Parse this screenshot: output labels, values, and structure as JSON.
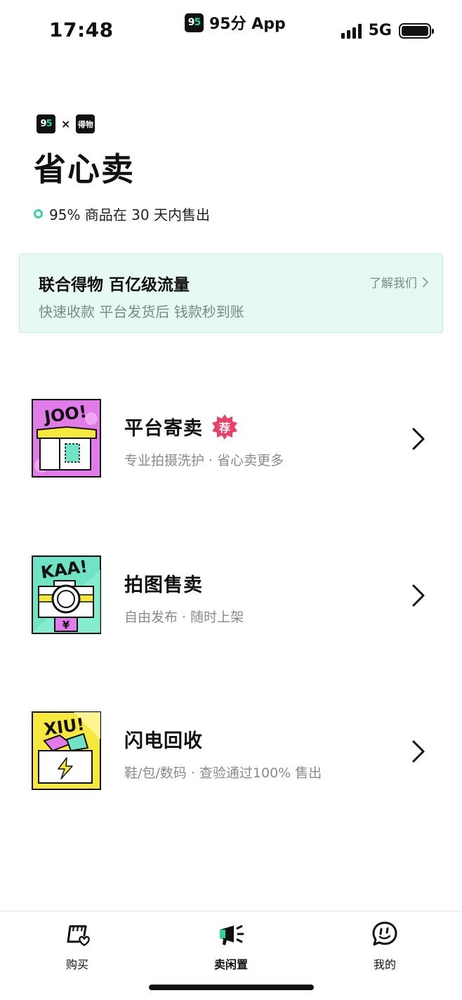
{
  "status_bar": {
    "time": "17:48",
    "app_icon_text_a": "9",
    "app_icon_text_b": "5",
    "app_name": "95分 App",
    "network": "5G",
    "battery_level": 1.0
  },
  "header": {
    "logo_95_a": "9",
    "logo_95_b": "5",
    "cross": "×",
    "logo_dewu": "得物",
    "title": "省心卖",
    "stat": "95% 商品在 30 天内售出"
  },
  "banner": {
    "title": "联合得物 百亿级流量",
    "subtitle": "快速收款 平台发货后 钱款秒到账",
    "link_label": "了解我们"
  },
  "options": [
    {
      "title": "平台寄卖",
      "badge": "荐",
      "subtitle": "专业拍摄洗护 · 省心卖更多",
      "thumb_text": "JOO!",
      "thumb_color": "#e07be8"
    },
    {
      "title": "拍图售卖",
      "subtitle": "自由发布 · 随时上架",
      "thumb_text": "KAA!",
      "thumb_color": "#6fe3c3",
      "thumb_tag": "¥"
    },
    {
      "title": "闪电回收",
      "subtitle": "鞋/包/数码 · 查验通过100% 售出",
      "thumb_text": "XIU!",
      "thumb_color": "#f7e83d"
    }
  ],
  "tab_bar": {
    "tabs": [
      {
        "label": "购买",
        "icon": "shop-heart-icon",
        "active": false
      },
      {
        "label": "卖闲置",
        "icon": "megaphone-icon",
        "active": true
      },
      {
        "label": "我的",
        "icon": "chat-face-icon",
        "active": false
      }
    ]
  },
  "colors": {
    "accent": "#3ccfae",
    "banner_bg": "#e6f9f3",
    "badge": "#e8416a"
  }
}
